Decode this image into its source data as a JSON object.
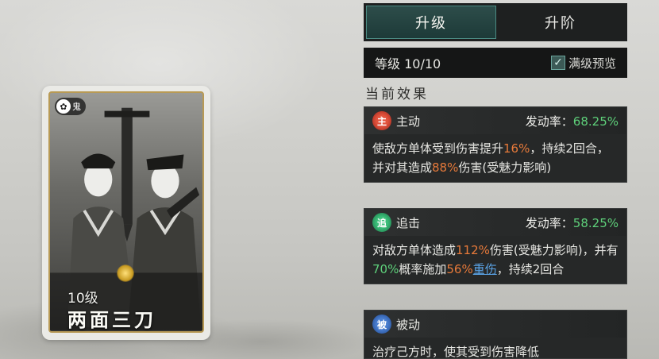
{
  "card": {
    "faction": "鬼",
    "level": "10级",
    "name": "两面三刀"
  },
  "tabs": {
    "upgrade": "升级",
    "advance": "升阶"
  },
  "level_bar": {
    "level": "等级 10/10",
    "preview_label": "满级预览",
    "preview_checked": true
  },
  "section_title": "当前效果",
  "effects": {
    "active": {
      "type_icon": "主",
      "type_label": "主动",
      "rate_label": "发动率：",
      "rate_value": "68.25%",
      "desc": {
        "p1": "使敌方单体受到伤害提升",
        "v1": "16%",
        "p2": "，持续2回合，并对其造成",
        "v2": "88%",
        "p3": "伤害(受魅力影响)"
      }
    },
    "pursuit": {
      "type_icon": "追",
      "type_label": "追击",
      "rate_label": "发动率：",
      "rate_value": "58.25%",
      "desc": {
        "p1": "对敌方单体造成",
        "v1": "112%",
        "p2": "伤害(受魅力影响)，并有",
        "v2": "70%",
        "p3": "概率施加",
        "v3": "56%",
        "link": "重伤",
        "p4": "，持续2回合"
      }
    },
    "passive": {
      "type_icon": "被",
      "type_label": "被动",
      "desc": "治疗己方时，使其受到伤害降低"
    }
  },
  "colors": {
    "accent_green": "#5ed07a",
    "accent_orange": "#e87a3a",
    "link_blue": "#5aa3e6",
    "tab_active": "#2d4d4a"
  }
}
